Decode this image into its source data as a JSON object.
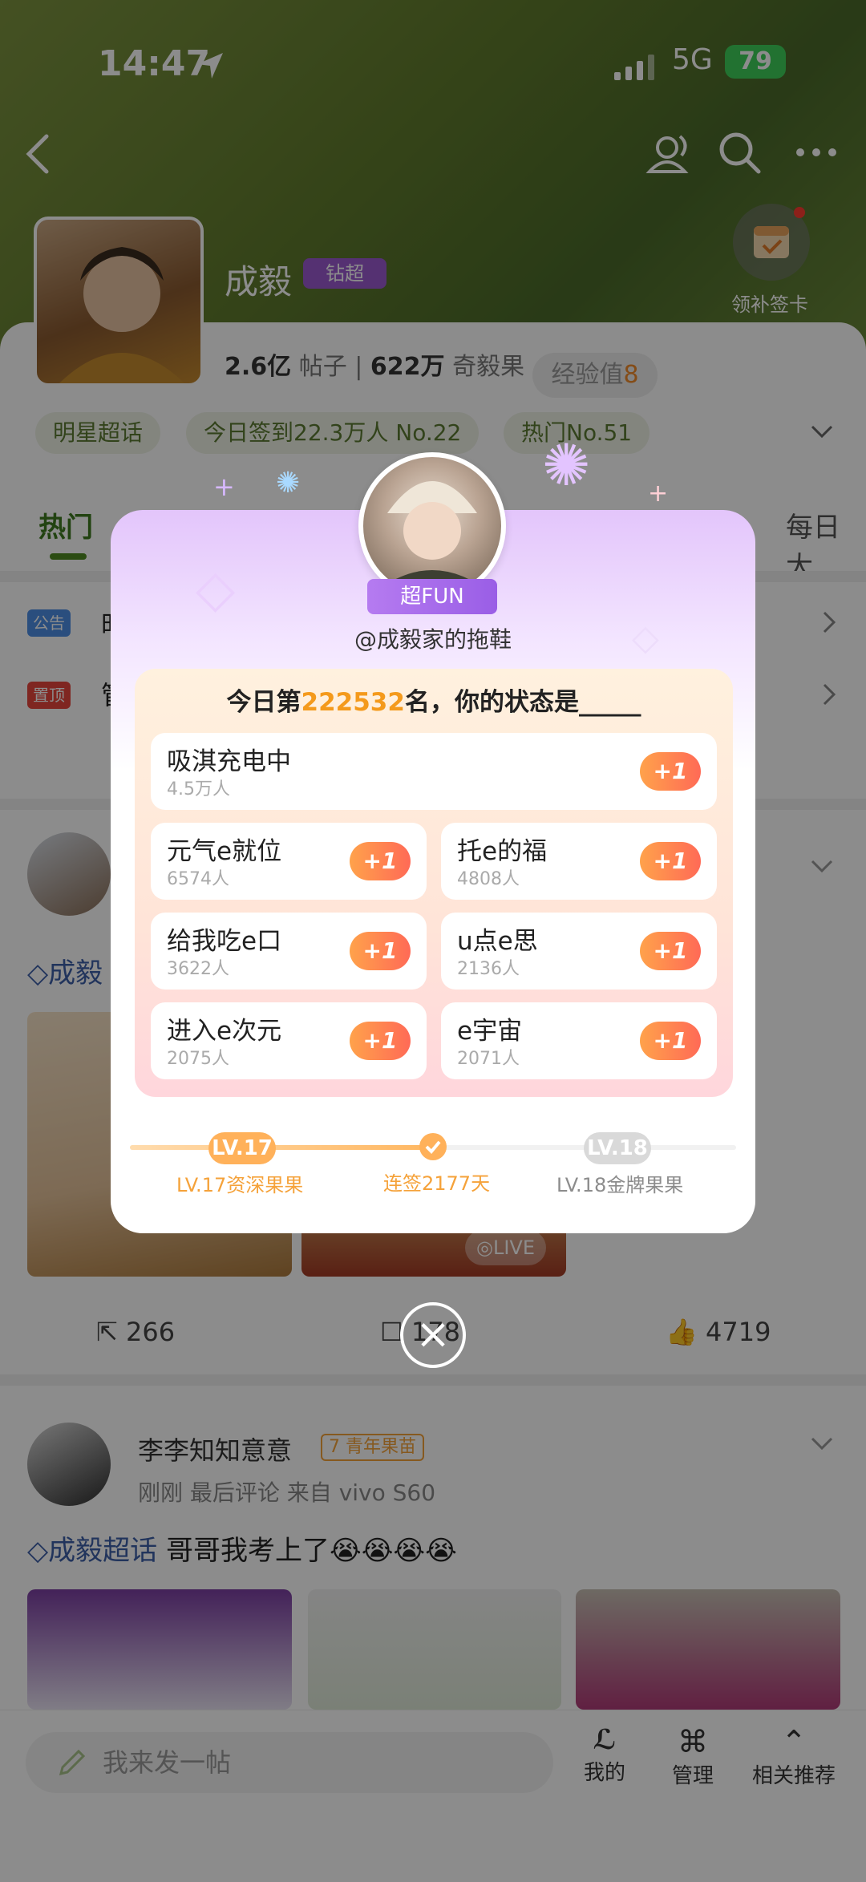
{
  "status_bar": {
    "time": "14:47",
    "network": "5G",
    "battery": "79"
  },
  "nav": {
    "back_icon": "chevron-left-icon",
    "icons": [
      "people-icon",
      "search-icon",
      "more-icon"
    ]
  },
  "checkin_card": {
    "label": "领补签卡"
  },
  "topic": {
    "name": "成毅",
    "vip_badge": "钻超",
    "posts_count": "2.6亿",
    "posts_label": "帖子",
    "fruit_count": "622万",
    "fruit_label": "奇毅果",
    "exp_label": "经验值",
    "exp_value": "8",
    "chips": [
      "明星超话",
      "今日签到22.3万人 No.22",
      "热门No.51"
    ]
  },
  "tabs": {
    "hot": "热门",
    "daily": "每日大"
  },
  "notices": {
    "announce_tag": "公告",
    "announce_text": "时",
    "pinned_tag": "置顶",
    "pinned_text": "管"
  },
  "post1": {
    "topic": "成毅",
    "live_label": "LIVE",
    "repost": "266",
    "comment": "178",
    "like": "4719"
  },
  "post2": {
    "user": "李李知知意意",
    "level": "7",
    "level_title": "青年果苗",
    "meta": "刚刚 最后评论  来自 vivo S60",
    "topic": "成毅超话",
    "text": "哥哥我考上了😭😭😭😭"
  },
  "bottom_bar": {
    "compose_placeholder": "我来发一帖",
    "mine": "我的",
    "manage": "管理",
    "recommend": "相关推荐"
  },
  "modal": {
    "badge": "超FUN",
    "username": "@成毅家的拖鞋",
    "question_prefix": "今日第",
    "rank": "222532",
    "question_suffix": "名，你的状态是_____",
    "options": [
      {
        "title": "吸淇充电中",
        "count": "4.5万人",
        "btn": "+1"
      },
      {
        "title": "元气e就位",
        "count": "6574人",
        "btn": "+1"
      },
      {
        "title": "托e的福",
        "count": "4808人",
        "btn": "+1"
      },
      {
        "title": "给我吃e口",
        "count": "3622人",
        "btn": "+1"
      },
      {
        "title": "u点e思",
        "count": "2136人",
        "btn": "+1"
      },
      {
        "title": "进入e次元",
        "count": "2075人",
        "btn": "+1"
      },
      {
        "title": "e宇宙",
        "count": "2071人",
        "btn": "+1"
      }
    ],
    "level_current": "LV.17",
    "level_current_label": "LV.17资深果果",
    "streak_label": "连签2177天",
    "level_next": "LV.18",
    "level_next_label": "LV.18金牌果果",
    "progress_fraction": 0.5
  },
  "colors": {
    "accent_green": "#4f8a22",
    "accent_orange": "#f49a1c",
    "modal_purple": "#b57bf0"
  }
}
